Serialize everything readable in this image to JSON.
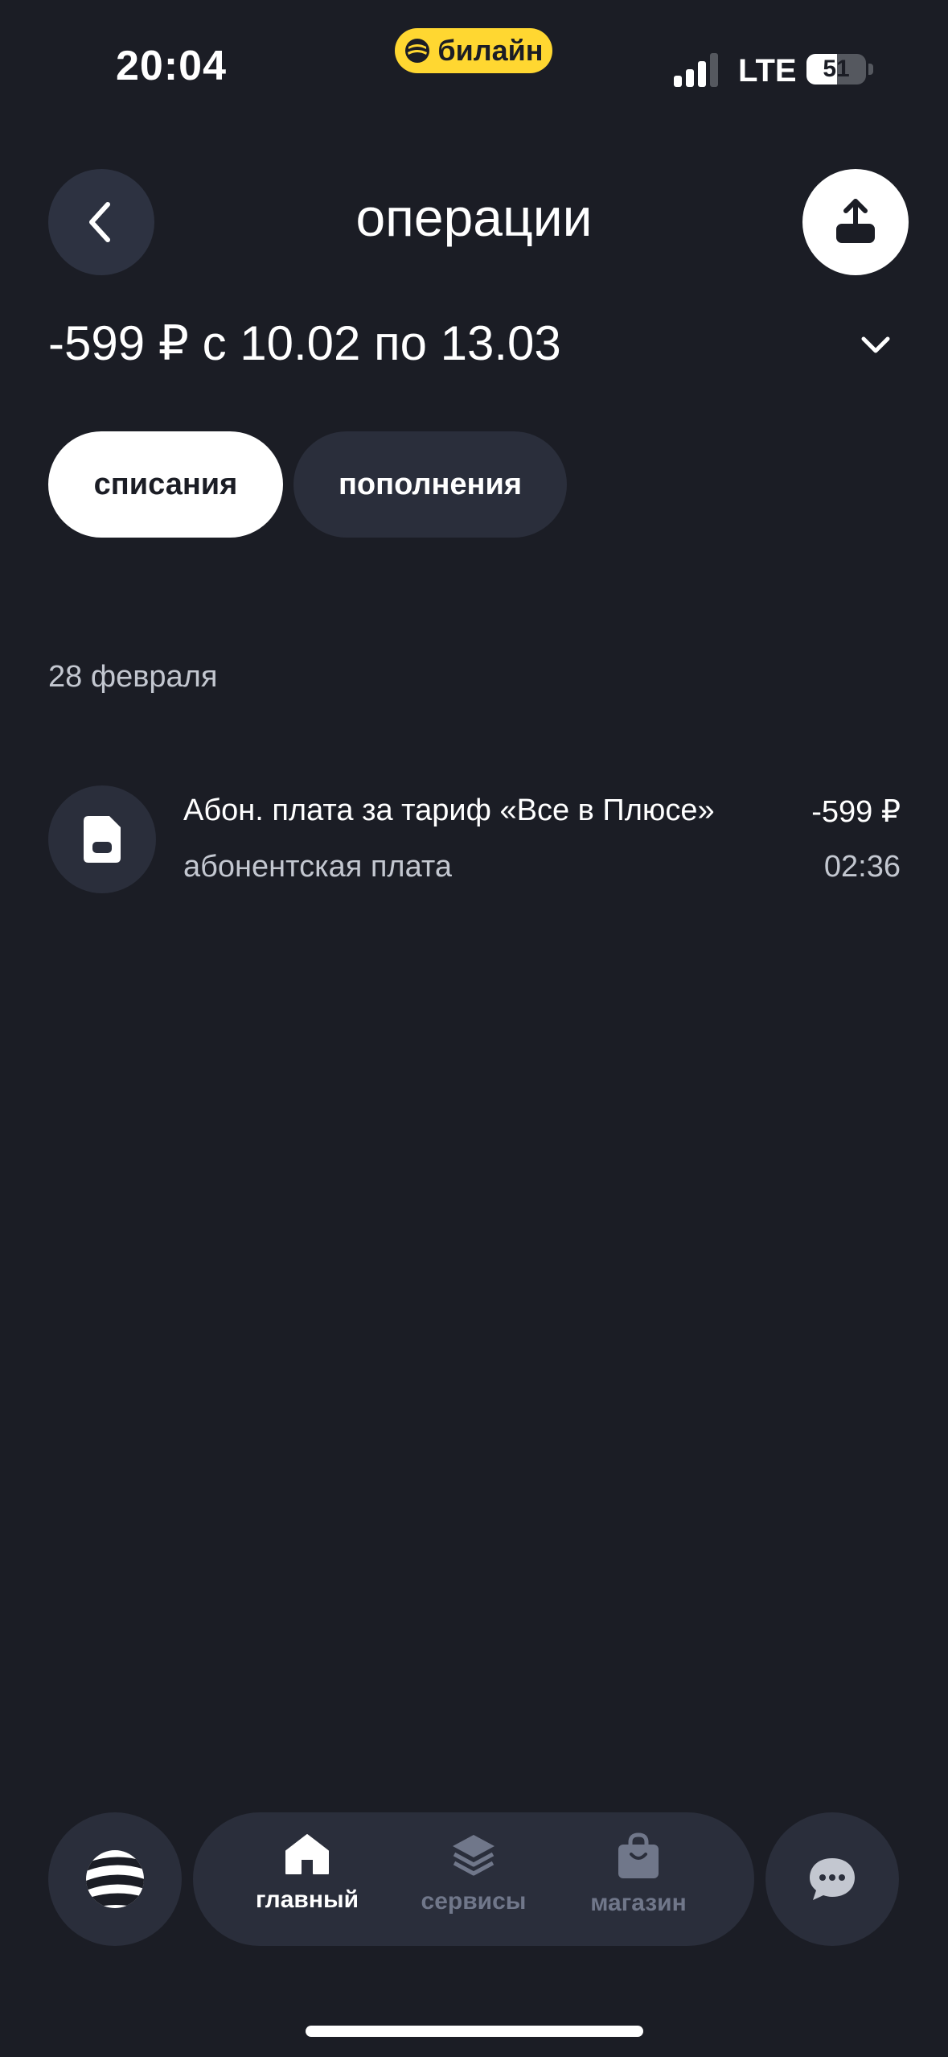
{
  "status_bar": {
    "time": "20:04",
    "carrier": "билайн",
    "network": "LTE",
    "battery_level": 51,
    "battery_label": "51",
    "carrier_color": "#ffd731"
  },
  "header": {
    "title": "операции",
    "back_icon": "chevron-left-icon",
    "share_icon": "upload-icon"
  },
  "summary": {
    "text": "-599 ₽ с 10.02 по 13.03",
    "toggle_icon": "chevron-down-icon"
  },
  "filters": [
    {
      "label": "списания",
      "active": true
    },
    {
      "label": "пополнения",
      "active": false
    }
  ],
  "groups": [
    {
      "date": "28 февраля",
      "operations": [
        {
          "title": "Абон. плата за тариф «Все в Плюсе»",
          "subtitle": "абонентская плата",
          "amount": "-599 ₽",
          "time": "02:36",
          "icon": "sim-card-icon"
        }
      ]
    }
  ],
  "bottom_nav": {
    "items": [
      {
        "label": "главный",
        "icon": "home-icon",
        "active": true
      },
      {
        "label": "сервисы",
        "icon": "layers-icon",
        "active": false
      },
      {
        "label": "магазин",
        "icon": "shopping-bag-icon",
        "active": false
      }
    ],
    "logo_icon": "beeline-logo-icon",
    "chat_icon": "chat-icon"
  },
  "colors": {
    "background": "#1b1d25",
    "surface": "#2a2e3b",
    "accent": "#ffd731",
    "muted_text": "#c3c7d0",
    "inactive_nav": "#70778a"
  }
}
